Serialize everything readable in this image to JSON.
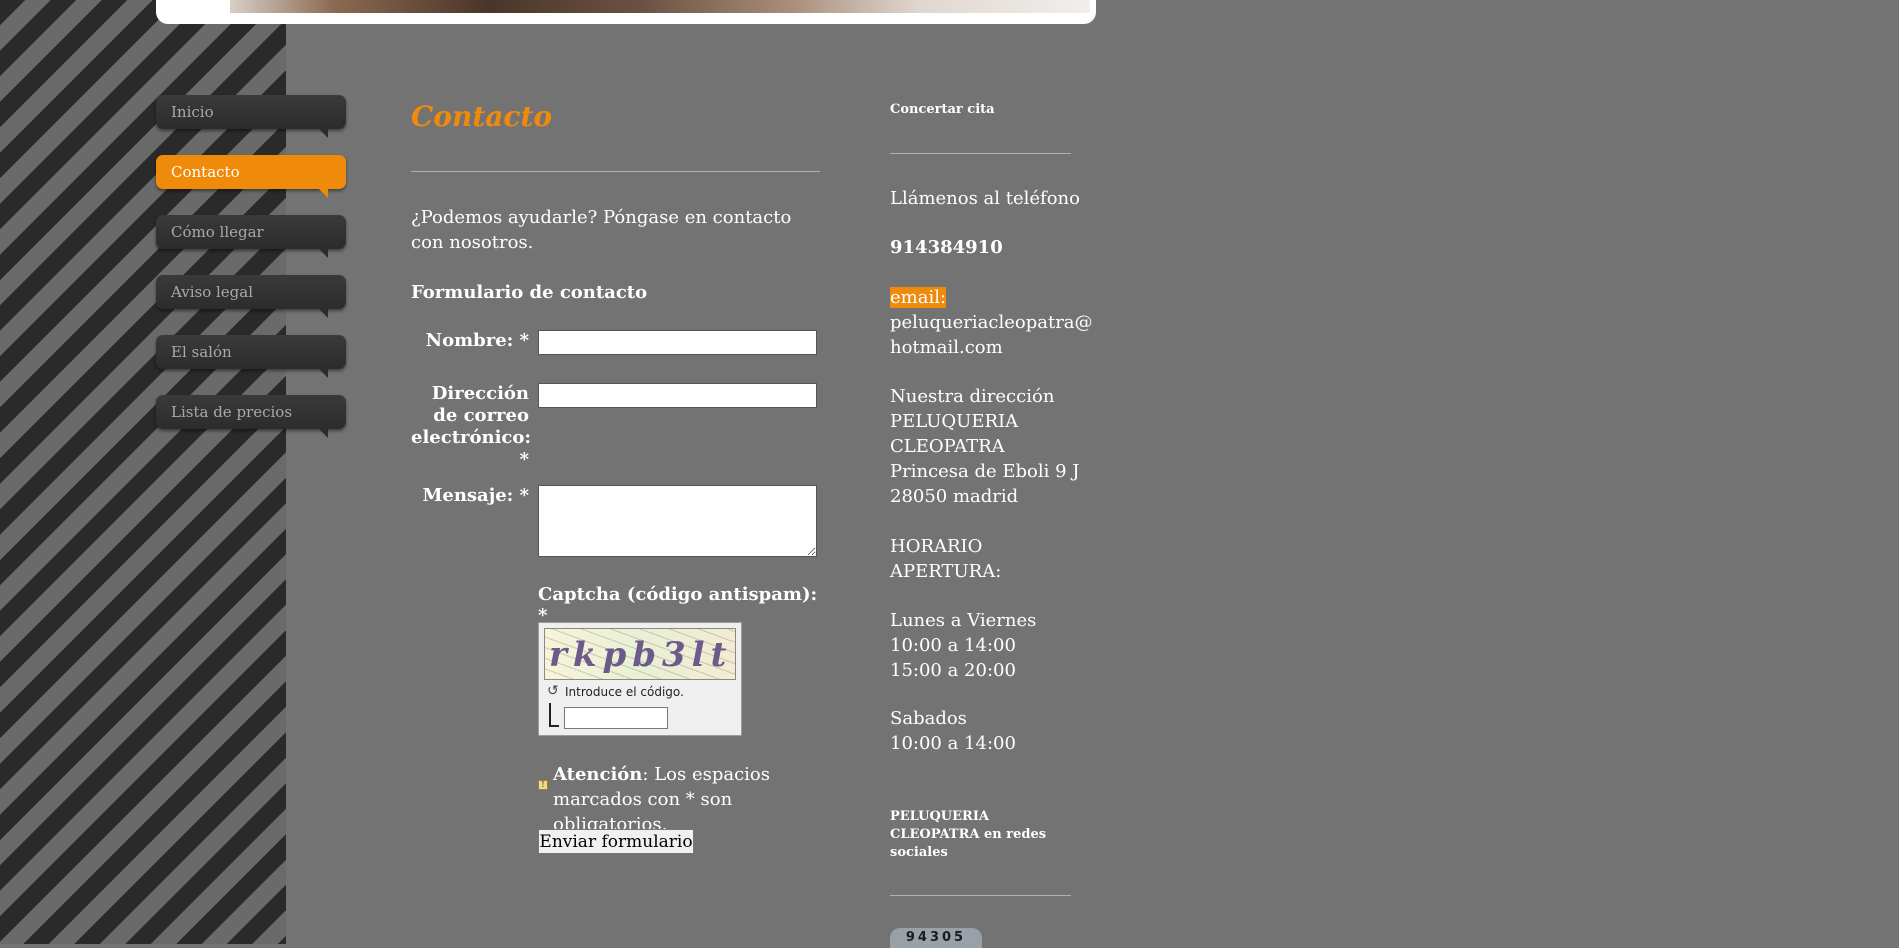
{
  "nav": {
    "items": [
      {
        "label": "Inicio",
        "active": false
      },
      {
        "label": "Contacto",
        "active": true
      },
      {
        "label": "Cómo llegar",
        "active": false
      },
      {
        "label": "Aviso legal",
        "active": false
      },
      {
        "label": "El salón",
        "active": false
      },
      {
        "label": "Lista de precios",
        "active": false
      }
    ]
  },
  "main": {
    "title": "Contacto",
    "intro": "¿Podemos ayudarle? Póngase en contacto con nosotros.",
    "form_title": "Formulario de contacto",
    "fields": {
      "name_label": "Nombre: *",
      "email_label": "Dirección de correo electrónico: *",
      "message_label": "Mensaje: *",
      "name_value": "",
      "email_value": "",
      "message_value": ""
    },
    "captcha": {
      "label": "Captcha (código antispam): *",
      "code": "rkpb3lt",
      "hint": "Introduce el código.",
      "value": ""
    },
    "warning": {
      "strong": "Atención",
      "text": ": Los espacios marcados con * son obligatorios."
    },
    "submit_label": "Enviar formulario"
  },
  "sidebar": {
    "heading": "Concertar cita",
    "call": "Llámenos al teléfono",
    "phone": "914384910",
    "email_label": "email:",
    "email_value": "peluqueriacleopatra@\nhotmail.com",
    "address": "Nuestra dirección\nPELUQUERIA\nCLEOPATRA\nPrincesa de Eboli 9 J\n28050 madrid",
    "hours_title": "HORARIO\nAPERTURA:",
    "weekdays": "Lunes a Viernes\n10:00 a 14:00\n15:00 a 20:00",
    "saturday": "Sabados\n10:00 a 14:00",
    "social_heading": "PELUQUERIA\nCLEOPATRA en redes\nsociales",
    "counter": "94305"
  },
  "colors": {
    "accent": "#f08a0b",
    "background": "#737373",
    "nav_dark": "#2c2c2c"
  },
  "icons": {
    "refresh": "refresh-icon",
    "warning": "warning-icon"
  }
}
